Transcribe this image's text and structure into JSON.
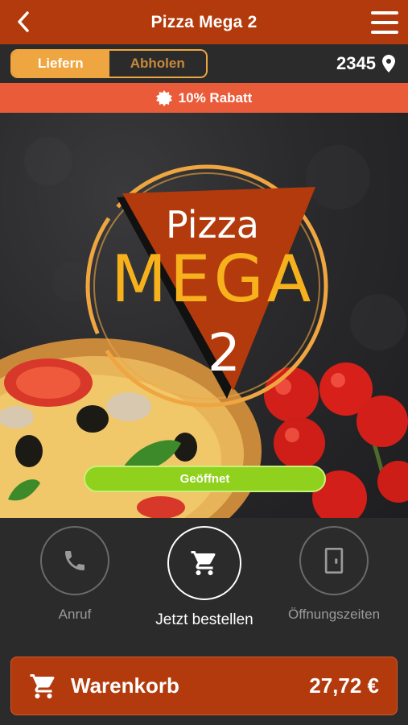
{
  "header": {
    "title": "Pizza Mega 2"
  },
  "mode_toggle": {
    "options": [
      {
        "label": "Liefern",
        "active": true
      },
      {
        "label": "Abholen",
        "active": false
      }
    ]
  },
  "location": {
    "postcode": "2345"
  },
  "discount": {
    "text": "10% Rabatt"
  },
  "hero": {
    "logo_line1": "Pizza",
    "logo_line2": "MEGA",
    "logo_number": "2",
    "status": "Geöffnet"
  },
  "actions": [
    {
      "label": "Anruf",
      "icon": "phone-icon"
    },
    {
      "label": "Jetzt bestellen",
      "icon": "cart-icon"
    },
    {
      "label": "Öffnungszeiten",
      "icon": "door-icon"
    }
  ],
  "cart": {
    "label": "Warenkorb",
    "total": "27,72 €"
  },
  "colors": {
    "primary": "#b23a0c",
    "accent": "#f0a640",
    "discount": "#ea5b39",
    "open": "#8fd11c",
    "background": "#2b2b2b"
  }
}
